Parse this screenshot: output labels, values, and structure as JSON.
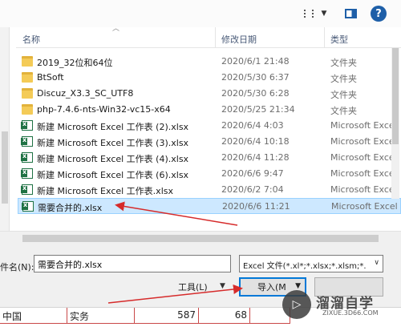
{
  "toolbar": {
    "view_icon": "view-details-icon",
    "pane_icon": "preview-pane-icon",
    "help_label": "?"
  },
  "columns": {
    "name": "名称",
    "date": "修改日期",
    "type": "类型"
  },
  "files": [
    {
      "name": "2019_32位和64位",
      "date": "2020/6/1 21:48",
      "type": "文件夹",
      "kind": "folder"
    },
    {
      "name": "BtSoft",
      "date": "2020/5/30 6:37",
      "type": "文件夹",
      "kind": "folder"
    },
    {
      "name": "Discuz_X3.3_SC_UTF8",
      "date": "2020/5/30 6:28",
      "type": "文件夹",
      "kind": "folder"
    },
    {
      "name": "php-7.4.6-nts-Win32-vc15-x64",
      "date": "2020/5/25 21:34",
      "type": "文件夹",
      "kind": "folder"
    },
    {
      "name": "新建 Microsoft Excel 工作表 (2).xlsx",
      "date": "2020/6/4 4:03",
      "type": "Microsoft Excel",
      "kind": "excel"
    },
    {
      "name": "新建 Microsoft Excel 工作表 (3).xlsx",
      "date": "2020/6/4 10:18",
      "type": "Microsoft Excel",
      "kind": "excel"
    },
    {
      "name": "新建 Microsoft Excel 工作表 (4).xlsx",
      "date": "2020/6/4 11:28",
      "type": "Microsoft Excel",
      "kind": "excel"
    },
    {
      "name": "新建 Microsoft Excel 工作表 (6).xlsx",
      "date": "2020/6/6 9:47",
      "type": "Microsoft Excel",
      "kind": "excel"
    },
    {
      "name": "新建 Microsoft Excel 工作表.xlsx",
      "date": "2020/6/2 7:04",
      "type": "Microsoft Excel",
      "kind": "excel"
    },
    {
      "name": "需要合并的.xlsx",
      "date": "2020/6/6 11:21",
      "type": "Microsoft Excel",
      "kind": "excel",
      "selected": true
    }
  ],
  "filename": {
    "label": "件名(N):",
    "value": "需要合并的.xlsx"
  },
  "filetype": {
    "value": "Excel 文件(*.xl*;*.xlsx;*.xlsm;*."
  },
  "buttons": {
    "tools": "工具(L)",
    "import": "导入(M"
  },
  "sheet": {
    "cells": [
      "中国",
      "实务",
      "587",
      "68",
      ""
    ]
  },
  "watermark": {
    "title": "溜溜自学",
    "subtitle": "ZIXUE.3D66.COM"
  },
  "colors": {
    "selection": "#cde8ff",
    "arrow": "#d62b2b",
    "accent": "#0078d7"
  }
}
